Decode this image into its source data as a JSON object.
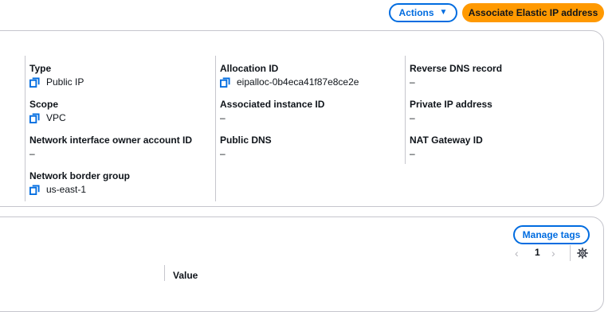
{
  "header": {
    "actions_label": "Actions",
    "primary_label": "Associate Elastic IP address"
  },
  "details": {
    "type": {
      "label": "Type",
      "value": "Public IP"
    },
    "scope": {
      "label": "Scope",
      "value": "VPC"
    },
    "owner": {
      "label": "Network interface owner account ID",
      "value": "–"
    },
    "border_group": {
      "label": "Network border group",
      "value": "us-east-1"
    },
    "allocation": {
      "label": "Allocation ID",
      "value": "eipalloc-0b4eca41f87e8ce2e"
    },
    "instance": {
      "label": "Associated instance ID",
      "value": "–"
    },
    "public_dns": {
      "label": "Public DNS",
      "value": "–"
    },
    "reverse_dns": {
      "label": "Reverse DNS record",
      "value": "–"
    },
    "private_ip": {
      "label": "Private IP address",
      "value": "–"
    },
    "nat": {
      "label": "NAT Gateway ID",
      "value": "–"
    }
  },
  "tags": {
    "manage_label": "Manage tags",
    "pager": {
      "prev": "‹",
      "page": "1",
      "next": "›"
    },
    "columns": {
      "value": "Value"
    }
  },
  "colors": {
    "accent": "#006ce0",
    "primary": "#ff9900",
    "border": "#c6c6cd"
  },
  "icons": [
    "caret-down-icon",
    "copy-icon",
    "settings-gear-icon"
  ]
}
